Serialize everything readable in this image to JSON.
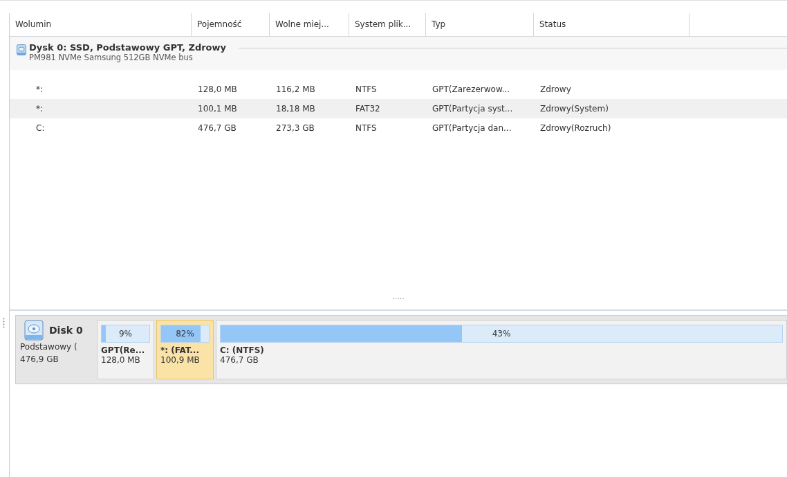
{
  "table": {
    "columns": [
      "Wolumin",
      "Pojemność",
      "Wolne miej...",
      "System plik...",
      "Typ",
      "Status"
    ],
    "disk_group": {
      "title": "Dysk 0: SSD, Podstawowy GPT, Zdrowy",
      "subtitle": "PM981 NVMe Samsung 512GB NVMe bus"
    },
    "rows": [
      {
        "cells": [
          "*:",
          "128,0 MB",
          "116,2 MB",
          "NTFS",
          "GPT(Zarezerwow...",
          "Zdrowy"
        ]
      },
      {
        "cells": [
          "*:",
          "100,1 MB",
          "18,18 MB",
          "FAT32",
          "GPT(Partycja syst...",
          "Zdrowy(System)"
        ]
      },
      {
        "cells": [
          "C:",
          "476,7 GB",
          "273,3 GB",
          "NTFS",
          "GPT(Partycja dan...",
          "Zdrowy(Rozruch)"
        ]
      }
    ]
  },
  "splitter": ".....",
  "disk_map": {
    "disk": {
      "name": "Disk 0",
      "type": "Podstawowy (",
      "size": "476,9 GB"
    },
    "partitions": [
      {
        "percent": "9%",
        "level": 0.09,
        "name": "GPT(Re...",
        "size": "128,0 MB",
        "selected": false
      },
      {
        "percent": "82%",
        "level": 0.82,
        "name": "*: (FAT...",
        "size": "100,9 MB",
        "selected": true
      },
      {
        "percent": "43%",
        "level": 0.43,
        "name": "C: (NTFS)",
        "size": "476,7 GB",
        "selected": false
      }
    ]
  }
}
